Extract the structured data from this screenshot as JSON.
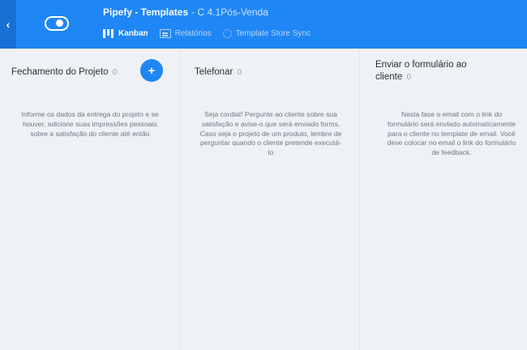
{
  "header": {
    "back_label": "‹",
    "title": "Pipefy - Templates",
    "subtitle": "- C 4.1Pós-Venda",
    "tabs": [
      {
        "label": "Kanban",
        "icon": "kanban-icon"
      },
      {
        "label": "Relatórios",
        "icon": "reports-icon"
      },
      {
        "label": "Template Store Sync",
        "icon": "sync-icon"
      }
    ]
  },
  "columns": [
    {
      "title": "Fechamento do Projeto",
      "count": "0",
      "add_label": "+",
      "description": "Informe os dados da entrega do projeto e se houver, adicione suas impressões pessoais sobre a satisfação do cliente até então"
    },
    {
      "title": "Telefonar",
      "count": "0",
      "description": "Seja cordial! Pergunte ao cliente sobre sua satisfação e avise-o que será enviado forms. Caso seja o projeto de um produto, lembre de perguntar quando o cliente pretende executá-lo"
    },
    {
      "title_line1": "Enviar o formulário ao",
      "title_line2": "cliente",
      "count": "0",
      "description": "Nesta fase o email com o link do formulário será enviado automaticamente para o cliente no template de email. Você deve colocar no email o link do formulário de feedback."
    }
  ],
  "colors": {
    "header_bg": "#1f86f5",
    "back_bg": "#1770d6",
    "board_bg": "#eef1f5",
    "accent": "#1f86f5"
  }
}
